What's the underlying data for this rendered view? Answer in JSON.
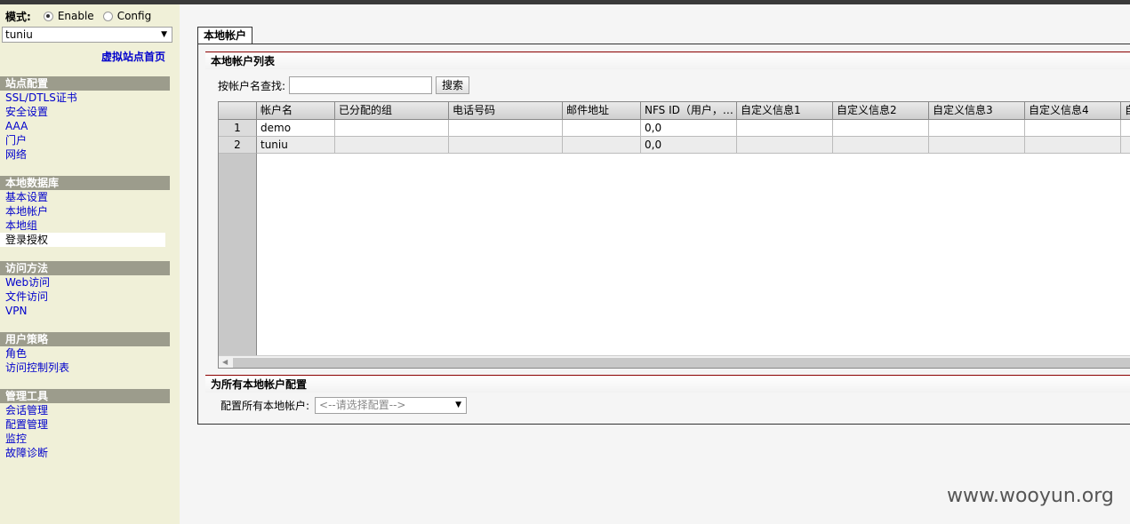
{
  "mode": {
    "label": "模式:",
    "options": [
      {
        "label": "Enable",
        "selected": true
      },
      {
        "label": "Config",
        "selected": false
      }
    ]
  },
  "site_select": {
    "value": "tuniu"
  },
  "home_link": "虚拟站点首页",
  "sidebar": {
    "sections": [
      {
        "title": "站点配置",
        "items": [
          "SSL/DTLS证书",
          "安全设置",
          "AAA",
          "门户",
          "网络"
        ]
      },
      {
        "title": "本地数据库",
        "items": [
          "基本设置",
          "本地帐户",
          "本地组",
          "登录授权"
        ],
        "active": "登录授权"
      },
      {
        "title": "访问方法",
        "items": [
          "Web访问",
          "文件访问",
          "VPN"
        ]
      },
      {
        "title": "用户策略",
        "items": [
          "角色",
          "访问控制列表"
        ]
      },
      {
        "title": "管理工具",
        "items": [
          "会话管理",
          "配置管理",
          "监控",
          "故障诊断"
        ]
      }
    ]
  },
  "tab": "本地帐户",
  "list_section": {
    "title": "本地帐户列表",
    "search_label": "按帐户名查找:",
    "search_value": "",
    "search_button": "搜索"
  },
  "grid": {
    "columns": [
      "帐户名",
      "已分配的组",
      "电话号码",
      "邮件地址",
      "NFS ID（用户，…",
      "自定义信息1",
      "自定义信息2",
      "自定义信息3",
      "自定义信息4",
      "自"
    ],
    "rows": [
      {
        "num": "1",
        "cells": [
          "demo",
          "",
          "",
          "",
          "0,0",
          "",
          "",
          "",
          "",
          ""
        ]
      },
      {
        "num": "2",
        "cells": [
          "tuniu",
          "",
          "",
          "",
          "0,0",
          "",
          "",
          "",
          "",
          ""
        ]
      }
    ]
  },
  "config_section": {
    "title": "为所有本地帐户配置",
    "label": "配置所有本地帐户:",
    "placeholder": "<--请选择配置-->"
  },
  "watermark": "www.wooyun.org"
}
